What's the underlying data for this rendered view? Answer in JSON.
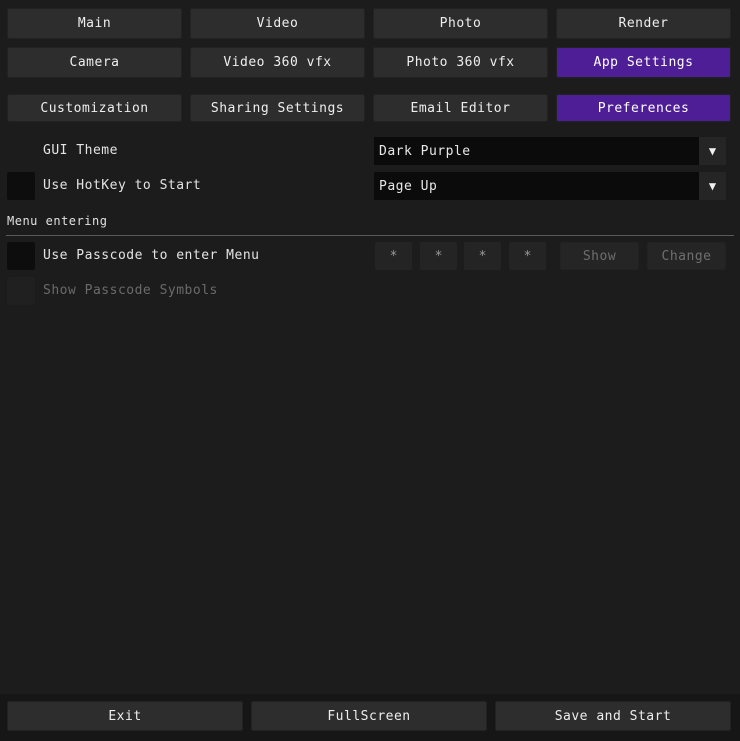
{
  "main_tabs_row1": [
    "Main",
    "Video",
    "Photo",
    "Render"
  ],
  "main_tabs_row2": [
    "Camera",
    "Video 360 vfx",
    "Photo 360 vfx",
    "App Settings"
  ],
  "sub_tabs": [
    "Customization",
    "Sharing Settings",
    "Email Editor",
    "Preferences"
  ],
  "active_main_tab": "App Settings",
  "active_sub_tab": "Preferences",
  "gui_theme": {
    "label": "GUI Theme",
    "value": "Dark Purple"
  },
  "hotkey": {
    "label": "Use HotKey to Start",
    "value": "Page Up",
    "checked": false
  },
  "menu_entering": {
    "section_title": "Menu entering",
    "passcode_label": "Use Passcode to enter Menu",
    "passcode_checked": false,
    "digits": [
      "*",
      "*",
      "*",
      "*"
    ],
    "show_label": "Show",
    "change_label": "Change",
    "show_symbols_label": "Show Passcode Symbols"
  },
  "footer": {
    "exit_label": "Exit",
    "fullscreen_label": "FullScreen",
    "save_start_label": "Save and Start"
  },
  "colors": {
    "accent": "#4e1e96",
    "background": "#1c1c1c",
    "button": "#2d2d2d"
  },
  "icons": {
    "dropdown_arrow": "triangle-down-icon"
  }
}
